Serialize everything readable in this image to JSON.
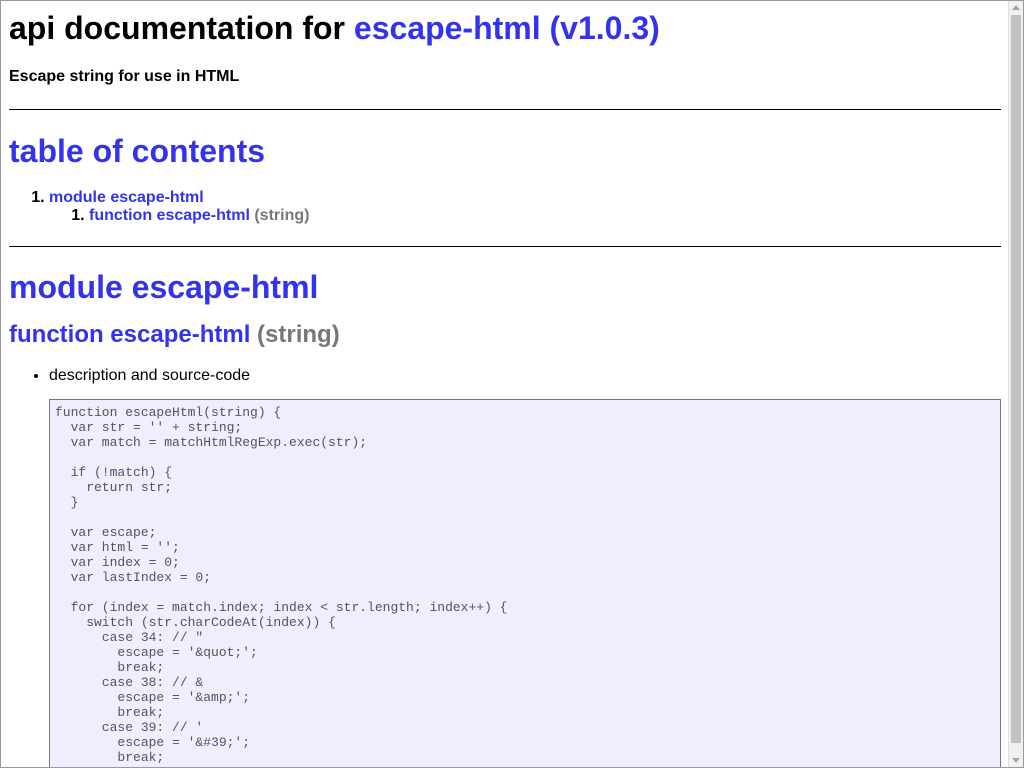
{
  "header": {
    "title_prefix": "api documentation for ",
    "title_link": "escape-html (v1.0.3)",
    "subtitle": "Escape string for use in HTML"
  },
  "toc": {
    "heading": "table of contents",
    "items": [
      {
        "label": "module escape-html",
        "children": [
          {
            "label": "function escape-html",
            "signature": " (string)"
          }
        ]
      }
    ]
  },
  "module": {
    "heading": "module escape-html",
    "function": {
      "name": "function escape-html",
      "signature": " (string)",
      "bullet": "description and source-code",
      "code": "function escapeHtml(string) {\n  var str = '' + string;\n  var match = matchHtmlRegExp.exec(str);\n\n  if (!match) {\n    return str;\n  }\n\n  var escape;\n  var html = '';\n  var index = 0;\n  var lastIndex = 0;\n\n  for (index = match.index; index < str.length; index++) {\n    switch (str.charCodeAt(index)) {\n      case 34: // \"\n        escape = '&quot;';\n        break;\n      case 38: // &\n        escape = '&amp;';\n        break;\n      case 39: // '\n        escape = '&#39;';\n        break;"
    }
  }
}
